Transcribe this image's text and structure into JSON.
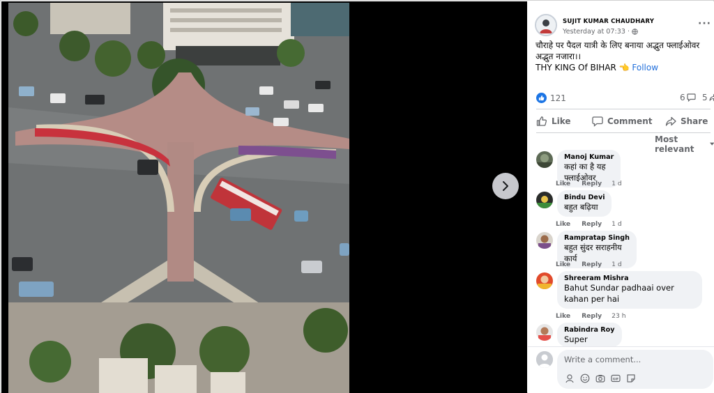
{
  "post": {
    "author": "SUJIT KUMAR CHAUDHARY",
    "time": "Yesterday at 07:33 ·",
    "privacy_icon": "globe-icon",
    "text_line1": "चौराहे पर पैदल यात्री के लिए बनाया अद्भुत फ्लाईओवर",
    "text_line2": "अद्भुत नजारा।।",
    "text_line3": "THY KING Of BIHAR 👈",
    "follow_label": "Follow"
  },
  "stats": {
    "reactions": "121",
    "comments": "6",
    "shares": "5"
  },
  "actions": {
    "like": "Like",
    "comment": "Comment",
    "share": "Share"
  },
  "sort_label": "Most relevant",
  "comments": [
    {
      "name": "Manoj Kumar",
      "text": "कहां का है यह फ्लाईओवर",
      "like": "Like",
      "reply": "Reply",
      "time": "1 d"
    },
    {
      "name": "Bindu Devi",
      "text": "बहुत बढ़िया",
      "like": "Like",
      "reply": "Reply",
      "time": "1 d"
    },
    {
      "name": "Rampratap Singh",
      "text": "बहुत सुंदर सराहनीय कार्य",
      "like": "Like",
      "reply": "Reply",
      "time": "1 d"
    },
    {
      "name": "Shreeram Mishra",
      "text": "Bahut Sundar padhaai over kahan per hai",
      "like": "Like",
      "reply": "Reply",
      "time": "23 h"
    },
    {
      "name": "Rabindra Roy",
      "text": "Super"
    }
  ],
  "composer": {
    "placeholder": "Write a comment..."
  },
  "colors": {
    "accent": "#1b74e4",
    "follow": "#216fdb",
    "bubble": "#f0f2f5",
    "secondary_text": "#65676b"
  }
}
